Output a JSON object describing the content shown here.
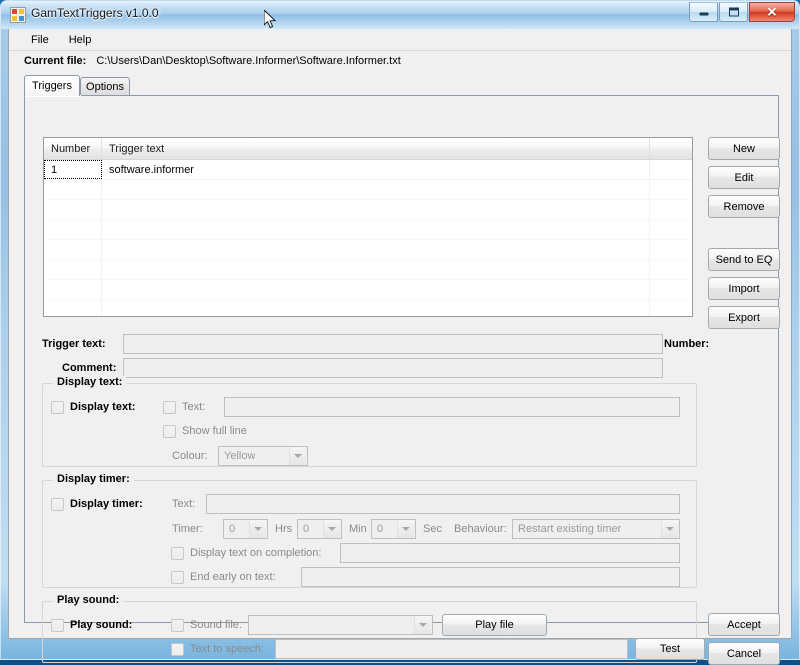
{
  "window": {
    "title": "GamTextTriggers v1.0.0",
    "icon": "app-grid-icon",
    "buttons": {
      "minimize": "Minimize",
      "maximize": "Maximize",
      "close": "Close"
    }
  },
  "menu": {
    "items": [
      {
        "label": "File"
      },
      {
        "label": "Help"
      }
    ]
  },
  "current_file": {
    "label": "Current file:",
    "value": "C:\\Users\\Dan\\Desktop\\Software.Informer\\Software.Informer.txt"
  },
  "tabs": [
    {
      "label": "Triggers",
      "active": true
    },
    {
      "label": "Options",
      "active": false
    }
  ],
  "list": {
    "columns": [
      "Number",
      "Trigger text",
      ""
    ],
    "rows": [
      {
        "number": "1",
        "trigger_text": "software.informer",
        "extra": ""
      }
    ]
  },
  "side_buttons": [
    {
      "label": "New"
    },
    {
      "label": "Edit"
    },
    {
      "label": "Remove"
    },
    {
      "label": "Send to EQ"
    },
    {
      "label": "Import"
    },
    {
      "label": "Export"
    }
  ],
  "fields": {
    "trigger_text_label": "Trigger text:",
    "trigger_text_value": "",
    "comment_label": "Comment:",
    "comment_value": "",
    "number_label": "Number:",
    "number_value": ""
  },
  "display_text": {
    "group_title": "Display text:",
    "enable_label": "Display text:",
    "enable_checked": false,
    "text_label": "Text:",
    "text_checked": false,
    "text_value": "",
    "show_full_line_label": "Show full line",
    "show_full_line_checked": false,
    "colour_label": "Colour:",
    "colour_value": "Yellow"
  },
  "display_timer": {
    "group_title": "Display timer:",
    "enable_label": "Display timer:",
    "enable_checked": false,
    "text_label": "Text:",
    "text_value": "",
    "timer_label": "Timer:",
    "hours_value": "0",
    "hours_unit": "Hrs",
    "minutes_value": "0",
    "minutes_unit": "Min",
    "seconds_value": "0",
    "seconds_unit": "Sec",
    "behaviour_label": "Behaviour:",
    "behaviour_value": "Restart existing timer",
    "completion_label": "Display text on completion:",
    "completion_checked": false,
    "completion_value": "",
    "end_early_label": "End early on text:",
    "end_early_checked": false,
    "end_early_value": ""
  },
  "play_sound": {
    "group_title": "Play sound:",
    "enable_label": "Play sound:",
    "enable_checked": false,
    "sound_file_label": "Sound file:",
    "sound_file_checked": false,
    "sound_file_value": "",
    "play_file_button": "Play file",
    "tts_label": "Text to speech:",
    "tts_checked": false,
    "tts_value": "",
    "test_button": "Test"
  },
  "dialog_buttons": {
    "accept": "Accept",
    "cancel": "Cancel"
  },
  "colors": {
    "window_face": "#f0f0f0",
    "disabled_field": "#efefef",
    "accent": "#3c7fb1",
    "title_text": "#10181f"
  }
}
